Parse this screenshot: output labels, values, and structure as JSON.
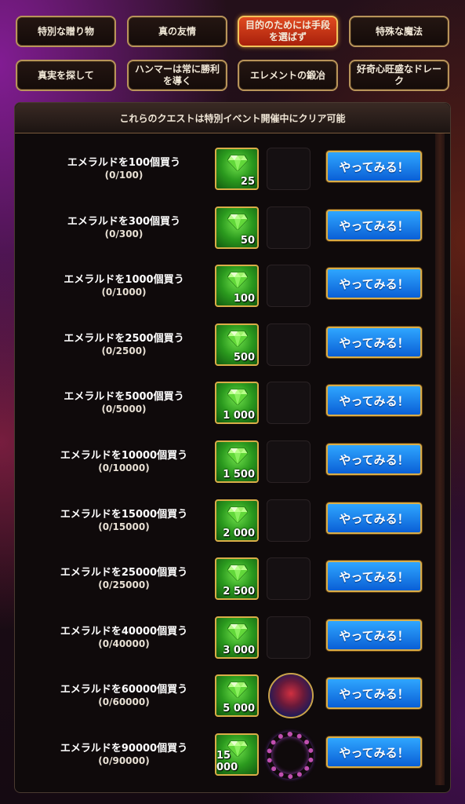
{
  "tabs": [
    {
      "label": "特別な贈り物",
      "active": false
    },
    {
      "label": "真の友情",
      "active": false
    },
    {
      "label": "目的のためには手段を選ばず",
      "active": true
    },
    {
      "label": "特殊な魔法",
      "active": false
    },
    {
      "label": "真実を探して",
      "active": false
    },
    {
      "label": "ハンマーは常に勝利を導く",
      "active": false
    },
    {
      "label": "エレメントの鍛冶",
      "active": false
    },
    {
      "label": "好奇心旺盛なドレーク",
      "active": false
    }
  ],
  "panel": {
    "header": "これらのクエストは特別イベント開催中にクリア可能"
  },
  "quests": [
    {
      "title": "エメラルドを100個買う",
      "progress": "(0/100)",
      "reward_amount": "25",
      "extra": "none",
      "button": "やってみる！"
    },
    {
      "title": "エメラルドを300個買う",
      "progress": "(0/300)",
      "reward_amount": "50",
      "extra": "none",
      "button": "やってみる！"
    },
    {
      "title": "エメラルドを1000個買う",
      "progress": "(0/1000)",
      "reward_amount": "100",
      "extra": "none",
      "button": "やってみる！"
    },
    {
      "title": "エメラルドを2500個買う",
      "progress": "(0/2500)",
      "reward_amount": "500",
      "extra": "none",
      "button": "やってみる！"
    },
    {
      "title": "エメラルドを5000個買う",
      "progress": "(0/5000)",
      "reward_amount": "1 000",
      "extra": "none",
      "button": "やってみる！"
    },
    {
      "title": "エメラルドを10000個買う",
      "progress": "(0/10000)",
      "reward_amount": "1 500",
      "extra": "none",
      "button": "やってみる！"
    },
    {
      "title": "エメラルドを15000個買う",
      "progress": "(0/15000)",
      "reward_amount": "2 000",
      "extra": "none",
      "button": "やってみる！"
    },
    {
      "title": "エメラルドを25000個買う",
      "progress": "(0/25000)",
      "reward_amount": "2 500",
      "extra": "none",
      "button": "やってみる！"
    },
    {
      "title": "エメラルドを40000個買う",
      "progress": "(0/40000)",
      "reward_amount": "3 000",
      "extra": "none",
      "button": "やってみる！"
    },
    {
      "title": "エメラルドを60000個買う",
      "progress": "(0/60000)",
      "reward_amount": "5 000",
      "extra": "portrait",
      "button": "やってみる！"
    },
    {
      "title": "エメラルドを90000個買う",
      "progress": "(0/90000)",
      "reward_amount": "15 000",
      "extra": "frame",
      "button": "やってみる！"
    }
  ],
  "colors": {
    "accent_gold": "#d9ad48",
    "active_tab": "#e04a20",
    "button_blue": "#1a82f0",
    "reward_green": "#2b9a1e"
  }
}
